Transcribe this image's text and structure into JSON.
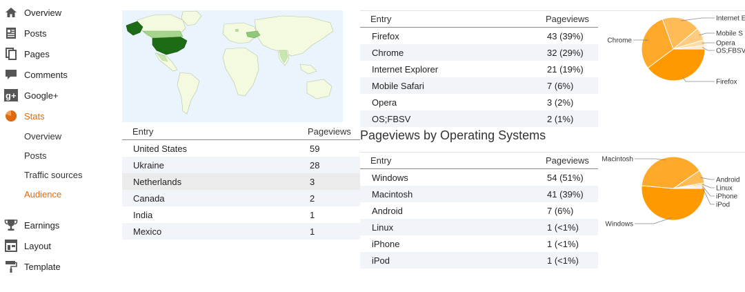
{
  "sidebar": {
    "items": [
      {
        "label": "Overview",
        "icon": "home-icon"
      },
      {
        "label": "Posts",
        "icon": "posts-icon"
      },
      {
        "label": "Pages",
        "icon": "pages-icon"
      },
      {
        "label": "Comments",
        "icon": "comments-icon"
      },
      {
        "label": "Google+",
        "icon": "google-plus-icon"
      },
      {
        "label": "Stats",
        "icon": "stats-pie-icon",
        "active": true
      },
      {
        "label": "Earnings",
        "icon": "trophy-icon"
      },
      {
        "label": "Layout",
        "icon": "layout-icon"
      },
      {
        "label": "Template",
        "icon": "paint-roller-icon"
      }
    ],
    "stats_subitems": [
      {
        "label": "Overview"
      },
      {
        "label": "Posts"
      },
      {
        "label": "Traffic sources"
      },
      {
        "label": "Audience",
        "active": true
      }
    ]
  },
  "countries": {
    "header": {
      "entry": "Entry",
      "pageviews": "Pageviews"
    },
    "rows": [
      {
        "entry": "United States",
        "pageviews": "59"
      },
      {
        "entry": "Ukraine",
        "pageviews": "28"
      },
      {
        "entry": "Netherlands",
        "pageviews": "3"
      },
      {
        "entry": "Canada",
        "pageviews": "2"
      },
      {
        "entry": "India",
        "pageviews": "1"
      },
      {
        "entry": "Mexico",
        "pageviews": "1"
      }
    ]
  },
  "browsers": {
    "header": {
      "entry": "Entry",
      "pageviews": "Pageviews"
    },
    "rows": [
      {
        "entry": "Firefox",
        "pageviews": "43 (39%)"
      },
      {
        "entry": "Chrome",
        "pageviews": "32 (29%)"
      },
      {
        "entry": "Internet Explorer",
        "pageviews": "21 (19%)"
      },
      {
        "entry": "Mobile Safari",
        "pageviews": "7 (6%)"
      },
      {
        "entry": "Opera",
        "pageviews": "3 (2%)"
      },
      {
        "entry": "OS;FBSV",
        "pageviews": "2 (1%)"
      }
    ],
    "pie_labels": [
      "Firefox",
      "Chrome",
      "Internet E",
      "Mobile S",
      "Opera",
      "OS;FBSV"
    ]
  },
  "os": {
    "title": "Pageviews by Operating Systems",
    "header": {
      "entry": "Entry",
      "pageviews": "Pageviews"
    },
    "rows": [
      {
        "entry": "Windows",
        "pageviews": "54 (51%)"
      },
      {
        "entry": "Macintosh",
        "pageviews": "41 (39%)"
      },
      {
        "entry": "Android",
        "pageviews": "7 (6%)"
      },
      {
        "entry": "Linux",
        "pageviews": "1 (<1%)"
      },
      {
        "entry": "iPhone",
        "pageviews": "1 (<1%)"
      },
      {
        "entry": "iPod",
        "pageviews": "1 (<1%)"
      }
    ],
    "pie_labels": [
      "Windows",
      "Macintosh",
      "Android",
      "Linux",
      "iPhone",
      "iPod"
    ]
  },
  "chart_data": [
    {
      "type": "pie",
      "categories": [
        "Firefox",
        "Chrome",
        "Internet Explorer",
        "Mobile Safari",
        "Opera",
        "OS;FBSV"
      ],
      "values": [
        43,
        32,
        21,
        7,
        3,
        2
      ]
    },
    {
      "type": "pie",
      "categories": [
        "Windows",
        "Macintosh",
        "Android",
        "Linux",
        "iPhone",
        "iPod"
      ],
      "values": [
        54,
        41,
        7,
        1,
        1,
        1
      ]
    }
  ],
  "colors": {
    "accent": "#dd6b11",
    "pie_main": "#ff9900",
    "map_ocean": "#e9f4fd",
    "map_land": "#f4fadf",
    "map_us": "#1e6b16",
    "map_ukraine": "#8fc879",
    "alt_row": "#f1f4f9"
  }
}
